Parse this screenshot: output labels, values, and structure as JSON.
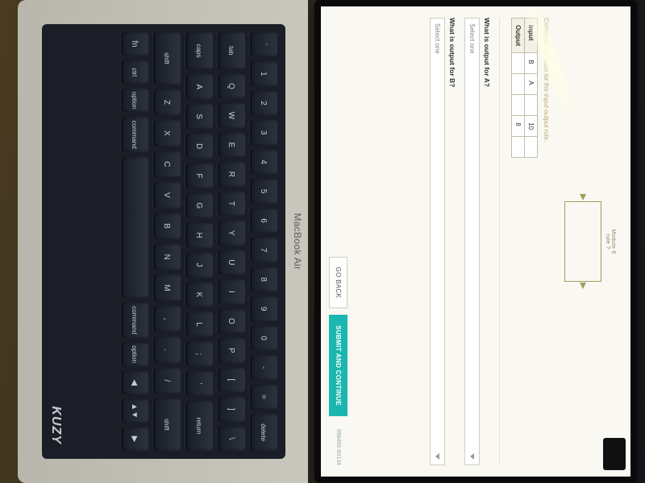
{
  "header": {
    "module_label": "Module 6",
    "rule_label": "rule ?"
  },
  "instruction": "Complete the table for the input-output rule.",
  "table": {
    "row_labels": [
      "Input",
      "Output"
    ],
    "inputs": [
      "B",
      "A",
      "",
      "10",
      ""
    ],
    "outputs": [
      "",
      "",
      "",
      "8",
      ""
    ]
  },
  "questions": {
    "a": {
      "prompt": "What is output for A?",
      "placeholder": "Select one"
    },
    "b": {
      "prompt": "What is output for B?",
      "placeholder": "Select one"
    }
  },
  "footer": {
    "back": "GO BACK",
    "submit": "SUBMIT AND CONTINUE",
    "id": "998495-90134"
  },
  "device": {
    "brand": "MacBook Air",
    "cover_brand": "KUZY"
  },
  "keys": {
    "row1": [
      "`",
      "1",
      "2",
      "3",
      "4",
      "5",
      "6",
      "7",
      "8",
      "9",
      "0",
      "-",
      "=",
      "delete"
    ],
    "row2": [
      "tab",
      "Q",
      "W",
      "E",
      "R",
      "T",
      "Y",
      "U",
      "I",
      "O",
      "P",
      "[",
      "]",
      "\\"
    ],
    "row3": [
      "caps",
      "A",
      "S",
      "D",
      "F",
      "G",
      "H",
      "J",
      "K",
      "L",
      ";",
      "'",
      "return"
    ],
    "row4": [
      "shift",
      "Z",
      "X",
      "C",
      "V",
      "B",
      "N",
      "M",
      ",",
      ".",
      "/",
      "shift"
    ],
    "row5": [
      "fn",
      "ctrl",
      "option",
      "command",
      "",
      "command",
      "option",
      "◀",
      "▲▼",
      "▶"
    ]
  }
}
